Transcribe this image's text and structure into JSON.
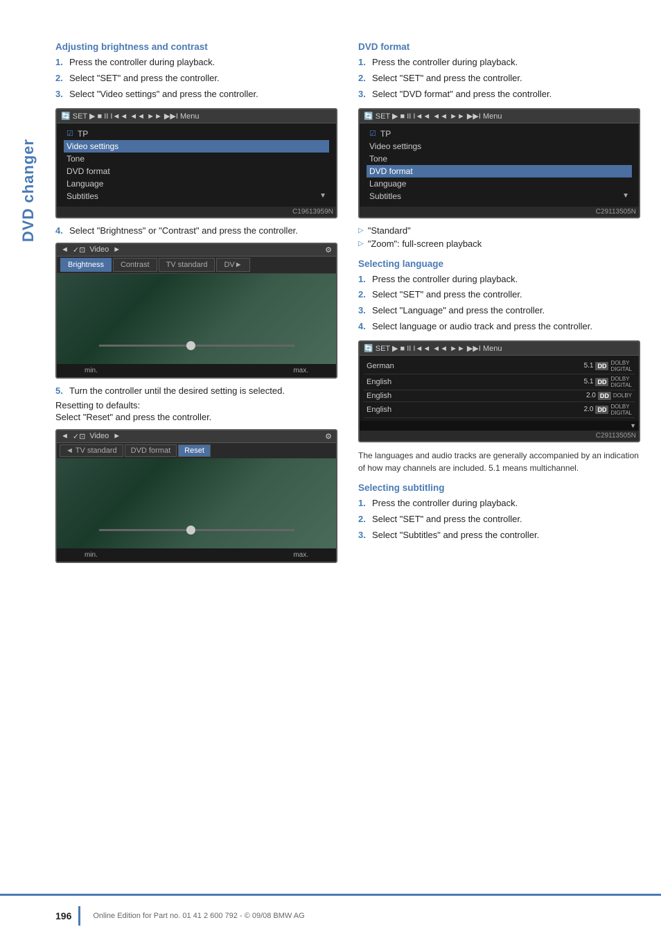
{
  "sidebar": {
    "label": "DVD changer"
  },
  "left_section": {
    "title": "Adjusting brightness and contrast",
    "steps": [
      {
        "num": "1.",
        "text": "Press the controller during playback."
      },
      {
        "num": "2.",
        "text": "Select \"SET\" and press the controller."
      },
      {
        "num": "3.",
        "text": "Select \"Video settings\" and press the controller."
      }
    ],
    "screen1": {
      "toolbar": "SET ▶ ■ II I◄◄ ◄◄ ►► ►►I Menu",
      "items": [
        {
          "text": "ℝ✓ TP",
          "highlighted": false
        },
        {
          "text": "Video settings",
          "highlighted": true
        },
        {
          "text": "Tone",
          "highlighted": false
        },
        {
          "text": "DVD format",
          "highlighted": false
        },
        {
          "text": "Language",
          "highlighted": false
        },
        {
          "text": "Subtitles",
          "highlighted": false
        }
      ],
      "note": ""
    },
    "step4": {
      "num": "4.",
      "text": "Select \"Brightness\" or \"Contrast\" and press the controller."
    },
    "screen2": {
      "toolbar": "◄ ✓⊡ Video ►",
      "tabs": [
        "Brightness",
        "Contrast",
        "TV standard",
        "DV►"
      ],
      "active_tab": "Brightness",
      "min_label": "min.",
      "max_label": "max."
    },
    "step5": {
      "num": "5.",
      "text": "Turn the controller until the desired setting is selected."
    },
    "resetting_title": "Resetting to defaults:",
    "resetting_text": "Select \"Reset\" and press the controller.",
    "screen3": {
      "toolbar": "◄ ✓⊡ Video ►",
      "tabs": [
        "TV standard",
        "DVD format",
        "Reset"
      ],
      "active_tab": "Reset",
      "min_label": "min.",
      "max_label": "max."
    }
  },
  "right_section": {
    "dvd_format": {
      "title": "DVD format",
      "steps": [
        {
          "num": "1.",
          "text": "Press the controller during playback."
        },
        {
          "num": "2.",
          "text": "Select \"SET\" and press the controller."
        },
        {
          "num": "3.",
          "text": "Select \"DVD format\" and press the controller."
        }
      ],
      "screen": {
        "toolbar": "SET ▶ ■ II I◄◄ ◄◄ ►► ►►I Menu",
        "items": [
          {
            "text": "ℝ✓ TP",
            "highlighted": false
          },
          {
            "text": "Video settings",
            "highlighted": false
          },
          {
            "text": "Tone",
            "highlighted": false
          },
          {
            "text": "DVD format",
            "highlighted": true
          },
          {
            "text": "Language",
            "highlighted": false
          },
          {
            "text": "Subtitles",
            "highlighted": false
          }
        ]
      },
      "arrow_items": [
        "\"Standard\"",
        "\"Zoom\": full-screen playback"
      ]
    },
    "selecting_language": {
      "title": "Selecting language",
      "steps": [
        {
          "num": "1.",
          "text": "Press the controller during playback."
        },
        {
          "num": "2.",
          "text": "Select \"SET\" and press the controller."
        },
        {
          "num": "3.",
          "text": "Select \"Language\" and press the controller."
        },
        {
          "num": "4.",
          "text": "Select language or audio track and press the controller."
        }
      ],
      "screen": {
        "toolbar": "SET ▶ ■ II I◄◄ ◄◄ ►► ►►I Menu",
        "rows": [
          {
            "lang": "German",
            "ch": "5.1",
            "badge": "DD DOLBY DIGITAL"
          },
          {
            "lang": "English",
            "ch": "5.1",
            "badge": "DD DOLBY DIGITAL"
          },
          {
            "lang": "English",
            "ch": "2.0",
            "badge": "DD DOLBY"
          },
          {
            "lang": "English",
            "ch": "2.0",
            "badge": "DD DOLBY DIGITAL"
          }
        ]
      },
      "note": "The languages and audio tracks are generally accompanied by an indication of how may channels are included. 5.1 means multichannel."
    },
    "selecting_subtitling": {
      "title": "Selecting subtitling",
      "steps": [
        {
          "num": "1.",
          "text": "Press the controller during playback."
        },
        {
          "num": "2.",
          "text": "Select \"SET\" and press the controller."
        },
        {
          "num": "3.",
          "text": "Select \"Subtitles\" and press the controller."
        }
      ]
    }
  },
  "footer": {
    "page_number": "196",
    "text": "Online Edition for Part no. 01 41 2 600 792 - © 09/08 BMW AG"
  }
}
